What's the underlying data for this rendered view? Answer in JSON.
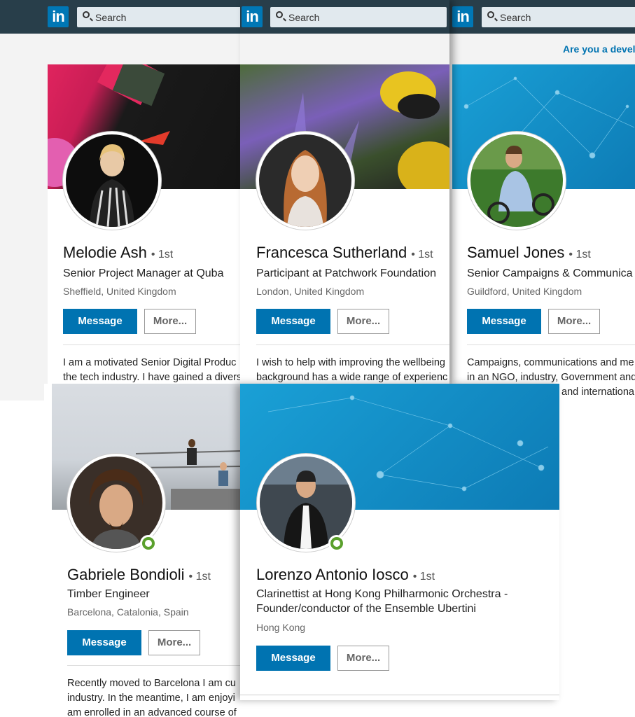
{
  "nav": {
    "logo": "in",
    "search_placeholder": "Search"
  },
  "promo": "Are you a develo",
  "buttons": {
    "message": "Message",
    "more": "More..."
  },
  "colors": {
    "brand": "#0077b5",
    "nav_bg": "#283e4a",
    "message_btn": "#0073b1",
    "online": "#5aa02c"
  },
  "profiles": [
    {
      "name": "Melodie Ash",
      "degree": "1st",
      "headline": "Senior Project Manager at Quba",
      "location": "Sheffield, United Kingdom",
      "summary": [
        "I am a motivated Senior Digital Produc",
        "the tech industry. I have gained a divers"
      ]
    },
    {
      "name": "Francesca Sutherland",
      "degree": "1st",
      "headline": "Participant at Patchwork Foundation",
      "location": "London, United Kingdom",
      "summary": [
        "I wish to help with improving the wellbeing",
        "background has a wide range of experienc"
      ]
    },
    {
      "name": "Samuel Jones",
      "degree": "1st",
      "headline": "Senior Campaigns & Communica",
      "location": "Guildford, United Kingdom",
      "summary": [
        "Campaigns, communications and me",
        "in an NGO, industry, Government and",
        "and internationa"
      ]
    },
    {
      "name": "Gabriele Bondioli",
      "degree": "1st",
      "headline": "Timber Engineer",
      "location": "Barcelona, Catalonia, Spain",
      "summary": [
        "Recently moved to Barcelona I am cu",
        "industry. In the meantime, I am enjoyi",
        "am enrolled in an advanced course of"
      ]
    },
    {
      "name": "Lorenzo Antonio Iosco",
      "degree": "1st",
      "headline": [
        "Clarinettist at Hong Kong Philharmonic Orchestra -",
        "Founder/conductor of the Ensemble Ubertini"
      ],
      "location": "Hong Kong"
    }
  ]
}
